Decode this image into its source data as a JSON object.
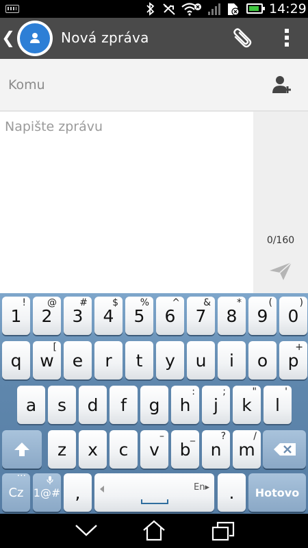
{
  "status": {
    "time": "14:29"
  },
  "app": {
    "title": "Nová zpráva"
  },
  "recipient": {
    "placeholder": "Komu"
  },
  "message": {
    "placeholder": "Napište zprávu",
    "counter": "0/160"
  },
  "keyboard": {
    "rows": [
      [
        {
          "m": "1",
          "s": "!"
        },
        {
          "m": "2",
          "s": "@"
        },
        {
          "m": "3",
          "s": "#"
        },
        {
          "m": "4",
          "s": "$"
        },
        {
          "m": "5",
          "s": "%"
        },
        {
          "m": "6",
          "s": "^"
        },
        {
          "m": "7",
          "s": "&"
        },
        {
          "m": "8",
          "s": "*"
        },
        {
          "m": "9",
          "s": "("
        },
        {
          "m": "0",
          "s": ")"
        }
      ],
      [
        {
          "m": "q",
          "s": ""
        },
        {
          "m": "w",
          "s": "["
        },
        {
          "m": "e",
          "s": ""
        },
        {
          "m": "r",
          "s": ""
        },
        {
          "m": "t",
          "s": ""
        },
        {
          "m": "y",
          "s": ""
        },
        {
          "m": "u",
          "s": ""
        },
        {
          "m": "i",
          "s": ""
        },
        {
          "m": "o",
          "s": ""
        },
        {
          "m": "p",
          "s": "+"
        }
      ],
      [
        {
          "m": "a",
          "s": ""
        },
        {
          "m": "s",
          "s": ""
        },
        {
          "m": "d",
          "s": ""
        },
        {
          "m": "f",
          "s": ""
        },
        {
          "m": "g",
          "s": ""
        },
        {
          "m": "h",
          "s": ":"
        },
        {
          "m": "j",
          "s": ";"
        },
        {
          "m": "k",
          "s": "\""
        },
        {
          "m": "l",
          "s": "'"
        }
      ],
      [
        {
          "m": "z",
          "s": ""
        },
        {
          "m": "x",
          "s": ""
        },
        {
          "m": "c",
          "s": ""
        },
        {
          "m": "v",
          "s": "–"
        },
        {
          "m": "b",
          "s": "_"
        },
        {
          "m": "n",
          "s": "?"
        },
        {
          "m": "m",
          "s": "/"
        }
      ]
    ],
    "lang_key": "Cz",
    "symbols_key": "1@#",
    "comma_key": ",",
    "space_lang": "En",
    "period_key": ".",
    "done_key": "Hotovo"
  },
  "colors": {
    "accent": "#2d7fd6",
    "appbar": "#4a4a4a",
    "send_icon": "#b5b5b5"
  }
}
